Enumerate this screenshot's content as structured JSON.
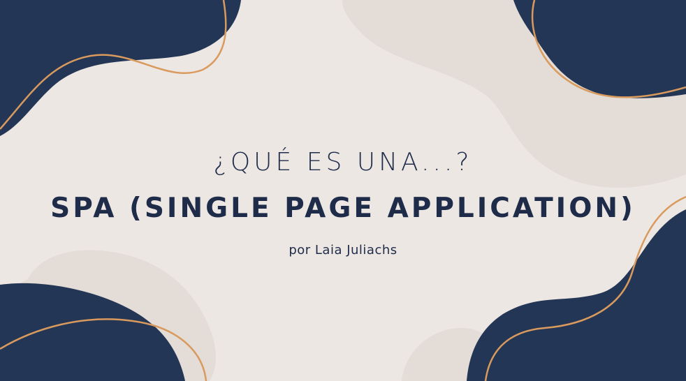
{
  "slide": {
    "question": "¿QUÉ ES UNA...?",
    "title": "SPA (SINGLE PAGE APPLICATION)",
    "author": "por Laia Juliachs"
  },
  "colors": {
    "background": "#ECE7E3",
    "light_blob": "#E3DCD7",
    "navy": "#243655",
    "accent_line": "#D99A5E"
  }
}
